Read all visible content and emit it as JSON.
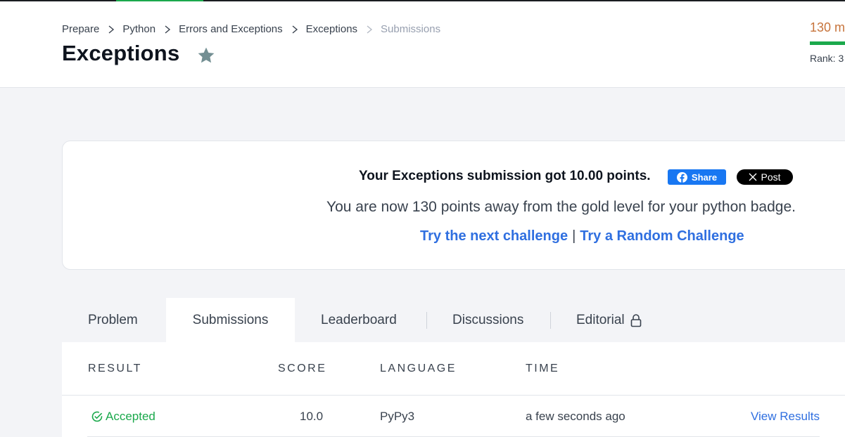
{
  "breadcrumb": [
    "Prepare",
    "Python",
    "Errors and Exceptions",
    "Exceptions",
    "Submissions"
  ],
  "page_title": "Exceptions",
  "profile": {
    "points_away_partial": "130 m",
    "rank_partial": "Rank: 3"
  },
  "banner": {
    "headline": "Your Exceptions submission got 10.00 points.",
    "share_label": "Share",
    "post_label": "Post",
    "message": "You are now 130 points away from the gold level for your python badge.",
    "next_challenge": "Try the next challenge",
    "divider": "|",
    "random_challenge": "Try a Random Challenge"
  },
  "tabs": [
    "Problem",
    "Submissions",
    "Leaderboard",
    "Discussions",
    "Editorial"
  ],
  "active_tab": "Submissions",
  "table": {
    "headers": [
      "RESULT",
      "SCORE",
      "LANGUAGE",
      "TIME"
    ],
    "rows": [
      {
        "result": "Accepted",
        "score": "10.0",
        "language": "PyPy3",
        "time": "a few seconds ago",
        "action": "View Results"
      }
    ]
  },
  "colors": {
    "accent_green": "#1ba94c",
    "link_blue": "#2f6fe0",
    "points_orange": "#c7743c",
    "facebook_blue": "#1877f2"
  }
}
